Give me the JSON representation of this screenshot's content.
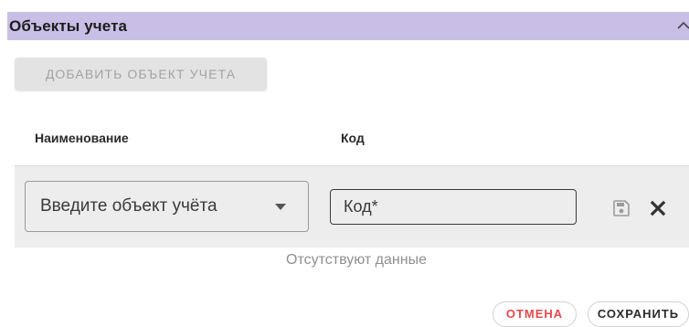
{
  "section": {
    "title": "Объекты учета",
    "header_color": "#c9bfe6",
    "collapse_icon": "chevron-up-icon"
  },
  "toolbar": {
    "add_label": "ДОБАВИТЬ ОБЪЕКТ УЧЕТА",
    "add_disabled": true
  },
  "table": {
    "columns": [
      "Наименование",
      "Код"
    ],
    "edit_row": {
      "object_placeholder": "Введите объект учёта",
      "object_dropdown_icon": "caret-down-icon",
      "code_value": "",
      "code_placeholder": "Код*",
      "save_icon": "floppy-disk-icon",
      "delete_icon": "close-icon"
    },
    "empty_text": "Отсутствуют данные"
  },
  "footer": {
    "cancel_label": "ОТМЕНА",
    "cancel_color": "#e5484d",
    "save_label": "СОХРАНИТЬ"
  }
}
